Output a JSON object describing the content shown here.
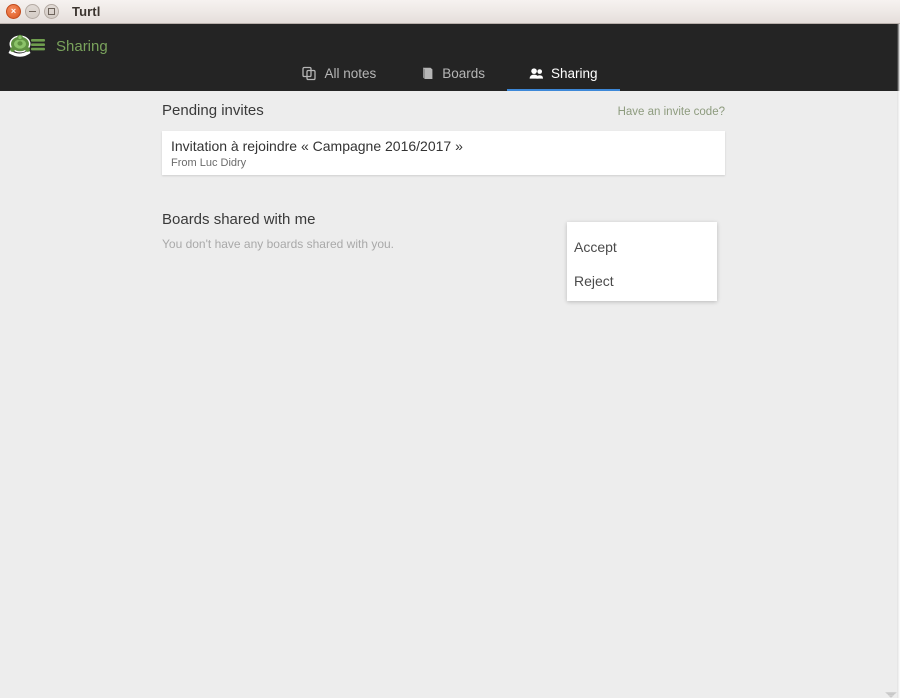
{
  "window": {
    "title": "Turtl",
    "controls": [
      {
        "name": "close",
        "glyph": "×"
      },
      {
        "name": "minimize",
        "glyph": ""
      },
      {
        "name": "maximize",
        "glyph": ""
      }
    ]
  },
  "header": {
    "brand_label": "Sharing",
    "logo_icon": "turtle-logo-icon",
    "accent_green": "#7aa35c",
    "background": "#242424",
    "tabs": [
      {
        "label": "All notes",
        "icon": "notes-copy-icon",
        "active": false
      },
      {
        "label": "Boards",
        "icon": "book-icon",
        "active": false
      },
      {
        "label": "Sharing",
        "icon": "people-icon",
        "active": true
      }
    ],
    "active_tab_underline_color": "#3d88d8"
  },
  "main": {
    "pending_invites": {
      "title": "Pending invites",
      "invite_code_link": "Have an invite code?",
      "link_color": "#8d9b7e",
      "items": [
        {
          "title": "Invitation à rejoindre « Campagne 2016/2017 »",
          "from": "From Luc Didry"
        }
      ]
    },
    "shared_boards": {
      "title": "Boards shared with me",
      "empty_message": "You don't have any boards shared with you."
    }
  },
  "dropdown": {
    "visible": true,
    "items": [
      {
        "label": "Accept"
      },
      {
        "label": "Reject"
      }
    ]
  }
}
